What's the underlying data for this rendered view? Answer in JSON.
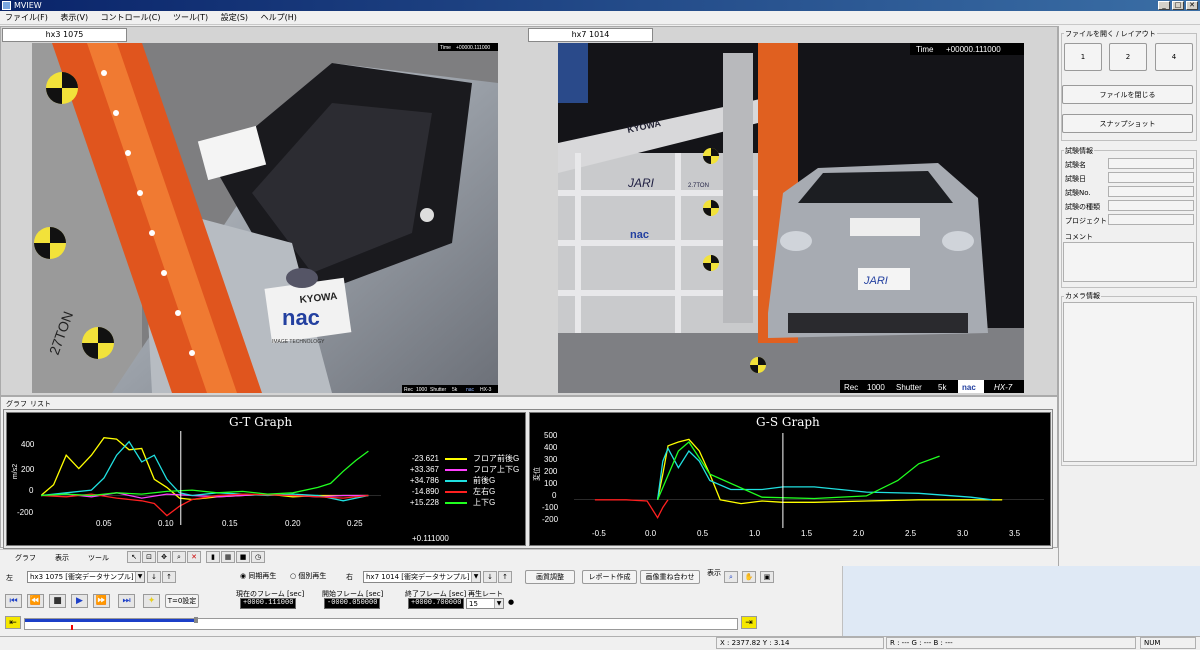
{
  "window": {
    "title": "MVIEW"
  },
  "menu": [
    "ファイル(F)",
    "表示(V)",
    "コントロール(C)",
    "ツール(T)",
    "設定(S)",
    "ヘルプ(H)"
  ],
  "left_pane": {
    "tab": "hx3 1075",
    "overlay": {
      "time_label": "Time",
      "time_value": "+00000.111000",
      "rec_label": "Rec",
      "rec_value": "1000",
      "shutter_label": "Shutter",
      "shutter_value": "5k",
      "brand": "nac",
      "model": "HX-3"
    },
    "scene_text": {
      "ton": "27TON",
      "kyowa": "KYOWA",
      "nac": "nac",
      "nac_sub": "IMAGE TECHNOLOGY"
    }
  },
  "right_pane": {
    "tab": "hx7 1014",
    "overlay": {
      "time_label": "Time",
      "time_value": "+00000.111000",
      "rec_label": "Rec",
      "rec_value": "1000",
      "shutter_label": "Shutter",
      "shutter_value": "5k",
      "brand": "nac",
      "model": "HX-7"
    },
    "scene_text": {
      "kyowa": "KYOWA",
      "jari": "JARI",
      "ton": "2.7TON",
      "nac": "nac",
      "plate": "JARI"
    }
  },
  "side_panel": {
    "layout_group": "ファイルを開く / レイアウト",
    "layout_buttons": [
      "1",
      "2",
      "4"
    ],
    "close_file": "ファイルを閉じる",
    "snapshot": "スナップショット",
    "test_info_group": "試験情報",
    "test_fields": [
      "試験名",
      "試験日",
      "試験No.",
      "試験の種類",
      "プロジェクト"
    ],
    "comment_label": "コメント",
    "camera_info_group": "カメラ情報"
  },
  "graph_tabs": [
    "グラフ",
    "リスト"
  ],
  "colors": {
    "yellow": "#ffff00",
    "magenta": "#ff40ff",
    "cyan": "#20e0e0",
    "red": "#ff2020",
    "green": "#20ff20",
    "cursor": "#ffffff"
  },
  "gt_graph": {
    "title": "G-T Graph",
    "ylabel": "m/s2",
    "yticks": [
      "400",
      "200",
      "0",
      "-200"
    ],
    "xticks": [
      "0.05",
      "0.10",
      "0.15",
      "0.20",
      "0.25"
    ],
    "cursor_value": "+0.111000",
    "legend": [
      {
        "value": "-23.621",
        "name": "フロア前後G",
        "color": "#ffff00"
      },
      {
        "value": "+33.367",
        "name": "フロア上下G",
        "color": "#ff40ff"
      },
      {
        "value": "+34.786",
        "name": "前後G",
        "color": "#20e0e0"
      },
      {
        "value": "-14.890",
        "name": "左右G",
        "color": "#ff2020"
      },
      {
        "value": "+15.228",
        "name": "上下G",
        "color": "#20ff20"
      }
    ]
  },
  "gs_graph": {
    "title": "G-S Graph",
    "ylabel": "変位",
    "yticks": [
      "500",
      "400",
      "300",
      "200",
      "100",
      "0",
      "-100",
      "-200"
    ],
    "xticks": [
      "-0.5",
      "0.0",
      "0.5",
      "1.0",
      "1.5",
      "2.0",
      "2.5",
      "3.0",
      "3.5"
    ]
  },
  "chart_data": [
    {
      "type": "line",
      "title": "G-T Graph",
      "ylabel": "m/s2",
      "xlim": [
        0,
        0.27
      ],
      "ylim": [
        -220,
        480
      ],
      "cursor_x": 0.111,
      "series": [
        {
          "name": "フロア前後G",
          "color": "#ffff00",
          "x": [
            0.0,
            0.01,
            0.02,
            0.03,
            0.04,
            0.05,
            0.06,
            0.07,
            0.08,
            0.09,
            0.1,
            0.11,
            0.12,
            0.14,
            0.16,
            0.18,
            0.2,
            0.22,
            0.24,
            0.26
          ],
          "y": [
            0,
            80,
            300,
            200,
            300,
            430,
            420,
            340,
            350,
            120,
            60,
            -20,
            -30,
            -10,
            0,
            10,
            -10,
            0,
            0,
            0
          ]
        },
        {
          "name": "フロア上下G",
          "color": "#ff40ff",
          "x": [
            0.0,
            0.02,
            0.04,
            0.06,
            0.08,
            0.1,
            0.12,
            0.14,
            0.16,
            0.18,
            0.2,
            0.22,
            0.24,
            0.26
          ],
          "y": [
            0,
            10,
            -10,
            20,
            -20,
            10,
            0,
            -10,
            0,
            10,
            0,
            -10,
            0,
            0
          ]
        },
        {
          "name": "前後G",
          "color": "#20e0e0",
          "x": [
            0.0,
            0.02,
            0.04,
            0.05,
            0.06,
            0.07,
            0.08,
            0.09,
            0.1,
            0.11,
            0.12,
            0.14,
            0.16,
            0.18,
            0.2,
            0.22,
            0.24,
            0.26
          ],
          "y": [
            0,
            20,
            40,
            130,
            300,
            400,
            250,
            300,
            120,
            20,
            0,
            20,
            10,
            0,
            10,
            0,
            -40,
            0
          ]
        },
        {
          "name": "左右G",
          "color": "#ff2020",
          "x": [
            0.0,
            0.02,
            0.04,
            0.06,
            0.08,
            0.09,
            0.1,
            0.11,
            0.12,
            0.14,
            0.16,
            0.2,
            0.24,
            0.26
          ],
          "y": [
            0,
            -10,
            10,
            -20,
            -40,
            -60,
            -150,
            -80,
            -30,
            0,
            10,
            0,
            -20,
            0
          ]
        },
        {
          "name": "上下G",
          "color": "#20ff20",
          "x": [
            0.0,
            0.02,
            0.04,
            0.06,
            0.08,
            0.1,
            0.12,
            0.14,
            0.16,
            0.18,
            0.2,
            0.22,
            0.23,
            0.24,
            0.25,
            0.26
          ],
          "y": [
            0,
            10,
            0,
            20,
            10,
            30,
            40,
            20,
            30,
            10,
            20,
            60,
            90,
            180,
            260,
            330
          ]
        }
      ]
    },
    {
      "type": "line",
      "title": "G-S Graph",
      "ylabel": "変位",
      "xlim": [
        -0.8,
        3.7
      ],
      "ylim": [
        -220,
        520
      ],
      "cursor_x": 1.2,
      "series": [
        {
          "name": "フロア前後G",
          "color": "#ffff00",
          "x": [
            0.0,
            0.05,
            0.1,
            0.2,
            0.3,
            0.4,
            0.5,
            0.6,
            0.8,
            1.0,
            1.2,
            1.5,
            2.0,
            2.5,
            3.0,
            3.3
          ],
          "y": [
            0,
            200,
            420,
            450,
            470,
            380,
            200,
            0,
            -30,
            -10,
            -20,
            -20,
            -10,
            0,
            0,
            0
          ]
        },
        {
          "name": "前後G",
          "color": "#20e0e0",
          "x": [
            0.0,
            0.05,
            0.1,
            0.2,
            0.3,
            0.4,
            0.5,
            0.7,
            1.0,
            1.2,
            1.5,
            2.0,
            2.5,
            3.0,
            3.2
          ],
          "y": [
            0,
            300,
            400,
            250,
            380,
            300,
            150,
            80,
            80,
            100,
            100,
            60,
            50,
            20,
            0
          ]
        },
        {
          "name": "左右G",
          "color": "#ff2020",
          "x": [
            -0.6,
            -0.3,
            -0.1,
            0.0,
            0.05,
            0.1
          ],
          "y": [
            0,
            0,
            -10,
            -140,
            -60,
            0
          ]
        },
        {
          "name": "上下G",
          "color": "#20ff20",
          "x": [
            0.0,
            0.2,
            0.3,
            0.5,
            1.0,
            1.5,
            2.0,
            2.3,
            2.5,
            2.7
          ],
          "y": [
            0,
            380,
            450,
            200,
            20,
            10,
            30,
            150,
            280,
            340
          ]
        }
      ]
    }
  ],
  "toolbar": {
    "graph": "グラフ",
    "view": "表示",
    "tool": "ツール"
  },
  "controls": {
    "left_label": "左",
    "left_combo": "hx3 1075 [衝突データサンプル]",
    "right_label": "右",
    "right_combo": "hx7 1014 [衝突データサンプル]",
    "sync_play": "同期再生",
    "indiv_play": "個別再生",
    "image_adjust": "画質調整",
    "report": "レポート作成",
    "overlay": "画像重ね合わせ",
    "display_label": "表示",
    "t0_set": "T=0設定",
    "cur_frame_label": "現在のフレーム [sec]",
    "cur_frame_value": "+0000.111000",
    "start_frame_label": "開始フレーム [sec]",
    "start_frame_value": "-0000.050000",
    "end_frame_label": "終了フレーム [sec]",
    "end_frame_value": "+0000.700000",
    "rate_label": "再生レート",
    "rate_value": "15",
    "progress": 0.24
  },
  "status": {
    "coords": "X : 2377.82  Y : 3.14",
    "rgb": "R : ---  G : ---  B : ---",
    "num": "NUM"
  }
}
